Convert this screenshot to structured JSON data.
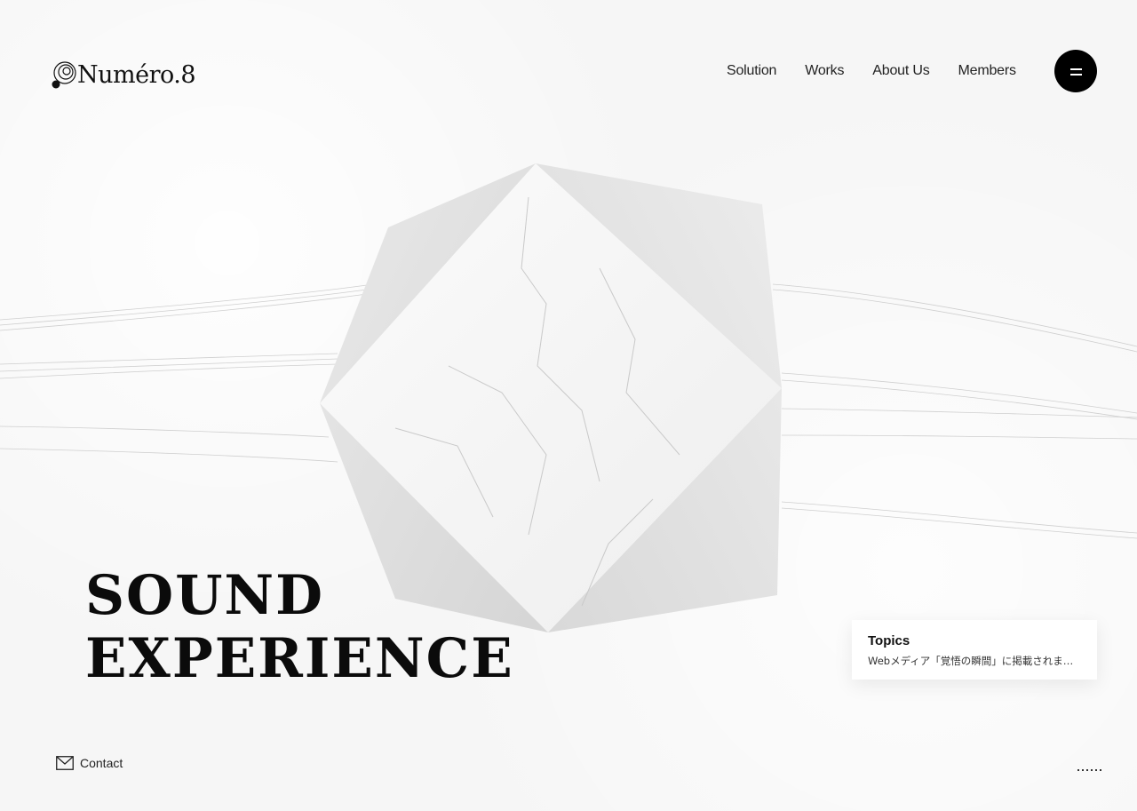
{
  "brand": {
    "name": "Numéro.8",
    "icon": "swirl-logo-icon"
  },
  "nav": {
    "items": [
      {
        "label": "Solution"
      },
      {
        "label": "Works"
      },
      {
        "label": "About Us"
      },
      {
        "label": "Members"
      }
    ],
    "menu_icon": "hamburger-icon"
  },
  "hero": {
    "line1": "SOUND",
    "line2": "EXPERIENCE",
    "visual": "marble-polyhedron"
  },
  "topics": {
    "title": "Topics",
    "text": "Webメディア「覚悟の瞬間」に掲載されました"
  },
  "footer": {
    "contact_label": "Contact",
    "contact_icon": "mail-icon",
    "scroll_indicator": "dotted-line-icon"
  },
  "colors": {
    "background": "#f6f6f6",
    "text": "#111111",
    "menu_button": "#000000",
    "card": "#ffffff"
  }
}
